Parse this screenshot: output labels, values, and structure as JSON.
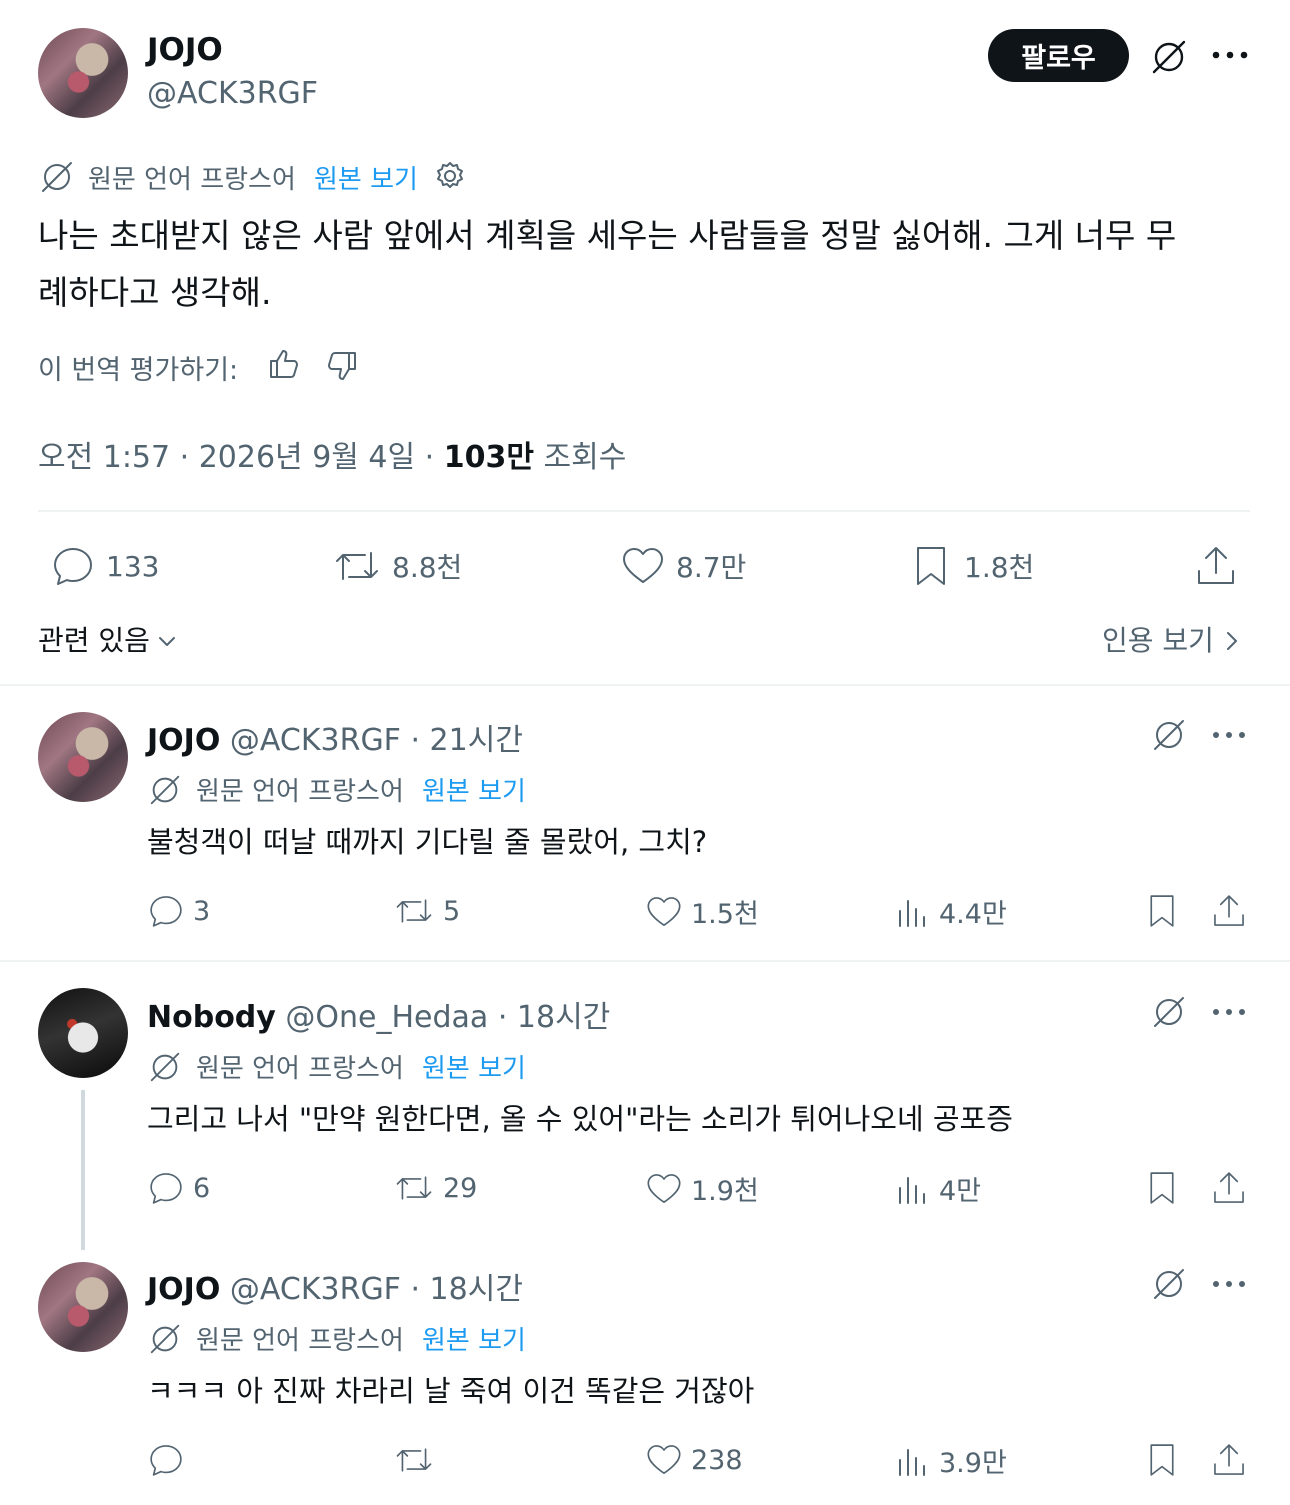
{
  "main_tweet": {
    "author_name": "JOJO",
    "author_handle": "@ACK3RGF",
    "follow_label": "팔로우",
    "translation_label": "원문 언어 프랑스어",
    "view_original_label": "원본 보기",
    "text_line1": "나는 초대받지 않은 사람 앞에서 계획을 세우는 사람들을 정말 싫어해. 그게 너무 무",
    "text_line2": "례하다고 생각해.",
    "rate_label": "이 번역 평가하기:",
    "time": "오전 1:57 · 2026년 9월 4일 · ",
    "views_count": "103만",
    "views_label": " 조회수",
    "stats": {
      "replies": "133",
      "retweets": "8.8천",
      "likes": "8.7만",
      "bookmarks": "1.8천"
    },
    "related_label": "관련 있음",
    "quotes_label": "인용 보기"
  },
  "replies": [
    {
      "name": "JOJO",
      "meta": "@ACK3RGF · 21시간",
      "translation_label": "원문 언어 프랑스어",
      "view_original_label": "원본 보기",
      "text": "불청객이 떠날 때까지 기다릴 줄 몰랐어, 그치?",
      "replies": "3",
      "retweets": "5",
      "likes": "1.5천",
      "views": "4.4만"
    },
    {
      "name": "Nobody",
      "meta": "@One_Hedaa · 18시간",
      "translation_label": "원문 언어 프랑스어",
      "view_original_label": "원본 보기",
      "text": "그리고 나서 \"만약 원한다면, 올 수 있어\"라는 소리가 튀어나오네 공포증",
      "replies": "6",
      "retweets": "29",
      "likes": "1.9천",
      "views": "4만"
    },
    {
      "name": "JOJO",
      "meta": "@ACK3RGF · 18시간",
      "translation_label": "원문 언어 프랑스어",
      "view_original_label": "원본 보기",
      "text": "ㅋㅋㅋ 아 진짜 차라리 날 죽여 이건 똑같은 거잖아",
      "replies": "",
      "retweets": "",
      "likes": "238",
      "views": "3.9만"
    }
  ]
}
